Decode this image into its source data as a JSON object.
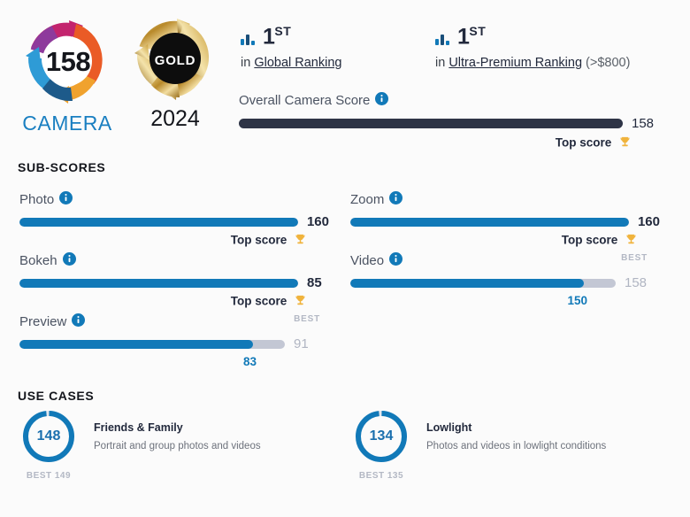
{
  "badge": {
    "score": "158",
    "label": "CAMERA",
    "ring_colors": [
      "#c3246e",
      "#8e3a9c",
      "#1a7fc1",
      "#1d5a8a",
      "#f0a22e",
      "#ea5b26"
    ]
  },
  "award": {
    "label": "GOLD",
    "year": "2024",
    "gold_color": "#b8892a",
    "center_color": "#0d0d0d"
  },
  "rankings": [
    {
      "icon": "bar-chart-icon",
      "rank": "1",
      "rank_suffix": "ST",
      "prefix": "in ",
      "link": "Global Ranking",
      "suffix": ""
    },
    {
      "icon": "bar-chart-icon",
      "rank": "1",
      "rank_suffix": "ST",
      "prefix": "in ",
      "link": "Ultra-Premium Ranking",
      "suffix": " (>$800)"
    }
  ],
  "overall": {
    "title": "Overall Camera Score",
    "info_icon": "info-icon",
    "value": "158",
    "note": "Top score",
    "trophy_icon": "trophy-icon",
    "bar_color": "#2e3446",
    "fill_percent": 100
  },
  "sections": {
    "subscores_title": "SUB-SCORES",
    "usecases_title": "USE CASES"
  },
  "subscores": [
    {
      "name": "Photo",
      "info_icon": "info-icon",
      "value": "160",
      "fill_percent": 100,
      "track_width": 315,
      "best_tag": "",
      "best_value": "",
      "note": "Top score",
      "note_type": "top",
      "trophy_icon": "trophy-icon"
    },
    {
      "name": "Zoom",
      "info_icon": "info-icon",
      "value": "160",
      "fill_percent": 100,
      "track_width": 315,
      "best_tag": "",
      "best_value": "",
      "note": "Top score",
      "note_type": "top",
      "trophy_icon": "trophy-icon"
    },
    {
      "name": "Bokeh",
      "info_icon": "info-icon",
      "value": "85",
      "fill_percent": 100,
      "track_width": 315,
      "best_tag": "",
      "best_value": "",
      "note": "Top score",
      "note_type": "top",
      "trophy_icon": "trophy-icon"
    },
    {
      "name": "Video",
      "info_icon": "info-icon",
      "value": "150",
      "fill_percent": 88,
      "track_width": 300,
      "best_tag": "BEST",
      "best_value": "158",
      "note": "150",
      "note_type": "score",
      "trophy_icon": ""
    },
    {
      "name": "Preview",
      "info_icon": "info-icon",
      "value": "83",
      "fill_percent": 88,
      "track_width": 300,
      "best_tag": "BEST",
      "best_value": "91",
      "note": "83",
      "note_type": "score",
      "trophy_icon": ""
    }
  ],
  "usecases": [
    {
      "value": "148",
      "best": "BEST 149",
      "title": "Friends & Family",
      "desc": "Portrait and group photos and videos",
      "ring_percent": 98
    },
    {
      "value": "134",
      "best": "BEST 135",
      "title": "Lowlight",
      "desc": "Photos and videos in lowlight conditions",
      "ring_percent": 98
    }
  ],
  "colors": {
    "accent_blue": "#1179b8",
    "dark_navy": "#2e3446",
    "track_gray": "#c3c7d4",
    "muted_gray": "#b0b5c2",
    "gold": "#f0b33c"
  }
}
